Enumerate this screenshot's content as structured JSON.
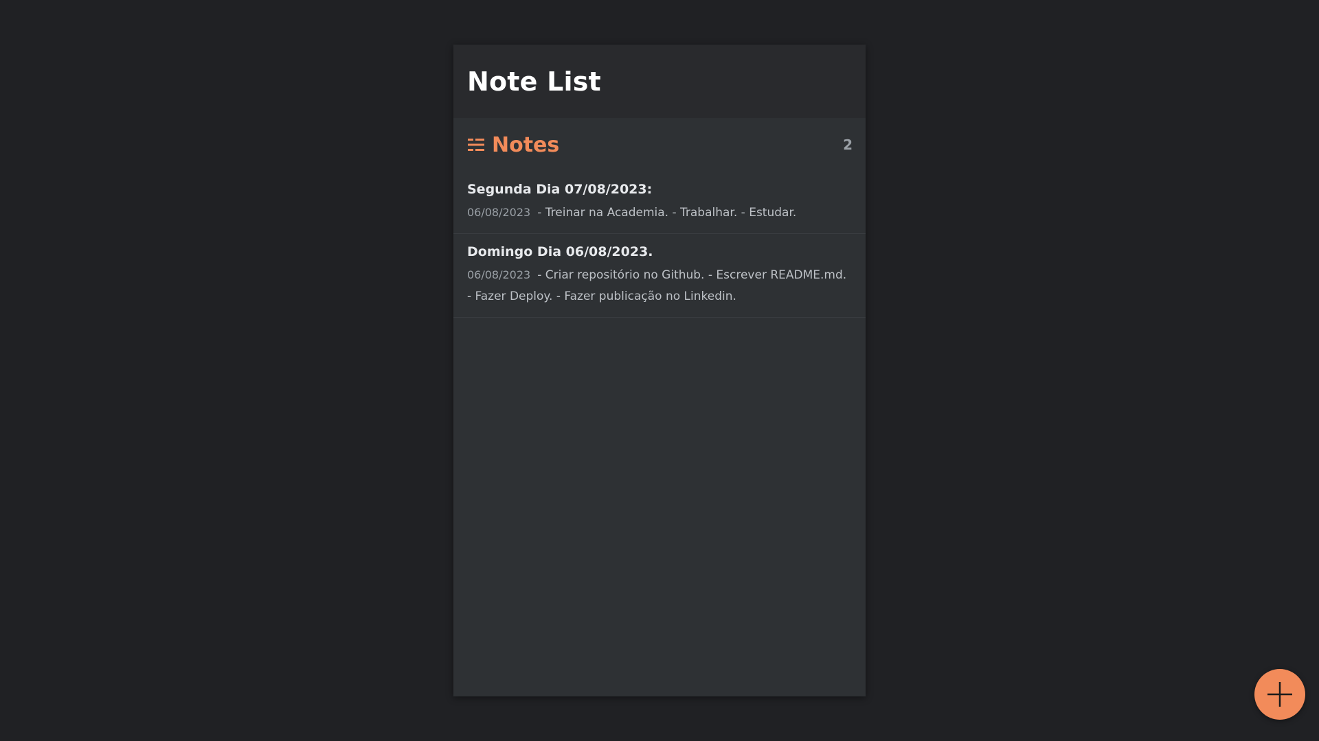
{
  "app": {
    "title": "Note List"
  },
  "notes_section": {
    "label": "Notes",
    "icon": "list-icon",
    "count": "2"
  },
  "notes": [
    {
      "title": "Segunda Dia 07/08/2023:",
      "date": "06/08/2023",
      "preview": "- Treinar na Academia. - Trabalhar. - Estudar."
    },
    {
      "title": "Domingo Dia 06/08/2023.",
      "date": "06/08/2023",
      "preview": "- Criar repositório no Github. - Escrever README.md. - Fazer Deploy. - Fazer publicação no Linkedin."
    }
  ],
  "fab": {
    "icon": "plus-icon"
  },
  "colors": {
    "background": "#202124",
    "panel": "#2e3134",
    "header": "#292a2d",
    "accent": "#f28b5a"
  }
}
